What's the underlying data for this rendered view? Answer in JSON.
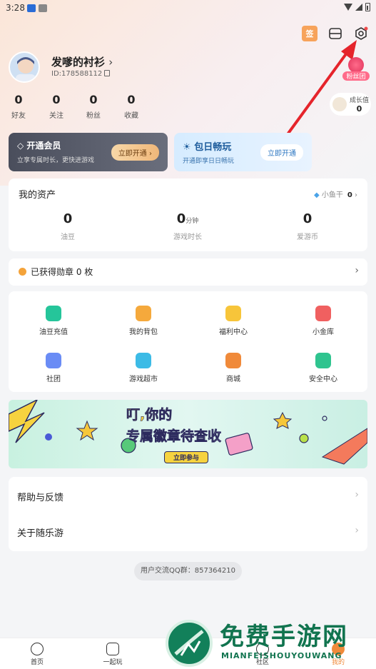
{
  "status_bar": {
    "time": "3:28"
  },
  "profile": {
    "name": "发嗲的衬衫",
    "id": "ID:178588112",
    "fan_group": "粉丝团"
  },
  "sign_icon": "签",
  "stats": [
    {
      "value": "0",
      "label": "好友"
    },
    {
      "value": "0",
      "label": "关注"
    },
    {
      "value": "0",
      "label": "粉丝"
    },
    {
      "value": "0",
      "label": "收藏"
    }
  ],
  "growth": {
    "label": "成长值",
    "value": "0"
  },
  "vip_card": {
    "title": "开通会员",
    "subtitle": "立享专属时长，更快进游戏",
    "button": "立即开通"
  },
  "daily_card": {
    "title": "包日畅玩",
    "subtitle": "开通即享日日畅玩",
    "button": "立即开通"
  },
  "assets": {
    "title": "我的资产",
    "fish_label": "小鱼干",
    "fish_value": "0",
    "items": [
      {
        "value": "0",
        "unit": "",
        "label": "油豆"
      },
      {
        "value": "0",
        "unit": "分钟",
        "label": "游戏时长"
      },
      {
        "value": "0",
        "unit": "",
        "label": "爱游币"
      }
    ]
  },
  "medal_text": "已获得勋章 0 枚",
  "grid_items": [
    {
      "label": "油豆充值",
      "icon": "youdou-recharge-icon",
      "color": "#25c59a"
    },
    {
      "label": "我的背包",
      "icon": "backpack-icon",
      "color": "#f5a93c"
    },
    {
      "label": "福利中心",
      "icon": "gift-icon",
      "color": "#f7c53a"
    },
    {
      "label": "小金库",
      "icon": "vault-icon",
      "color": "#f06060"
    },
    {
      "label": "社团",
      "icon": "club-icon",
      "color": "#6a8cf5"
    },
    {
      "label": "游戏超市",
      "icon": "basket-icon",
      "color": "#3cbbe6"
    },
    {
      "label": "商城",
      "icon": "shop-icon",
      "color": "#f08a3a"
    },
    {
      "label": "安全中心",
      "icon": "shield-icon",
      "color": "#2fc48f"
    }
  ],
  "banner": {
    "line1": "叮,你的",
    "line2": "专属徽章待查收",
    "button": "立即参与"
  },
  "menu": [
    {
      "label": "帮助与反馈"
    },
    {
      "label": "关于随乐游"
    }
  ],
  "qq_group": "用户交流QQ群：857364210",
  "tabs": [
    {
      "label": "首页",
      "icon": "home-icon"
    },
    {
      "label": "一起玩",
      "icon": "robot-icon"
    },
    {
      "label": "社区",
      "icon": "community-icon"
    },
    {
      "label": "我的",
      "icon": "profile-icon"
    }
  ],
  "watermark": {
    "cn": "免费手游网",
    "en": "MIANFEISHOUYOUWANG"
  }
}
